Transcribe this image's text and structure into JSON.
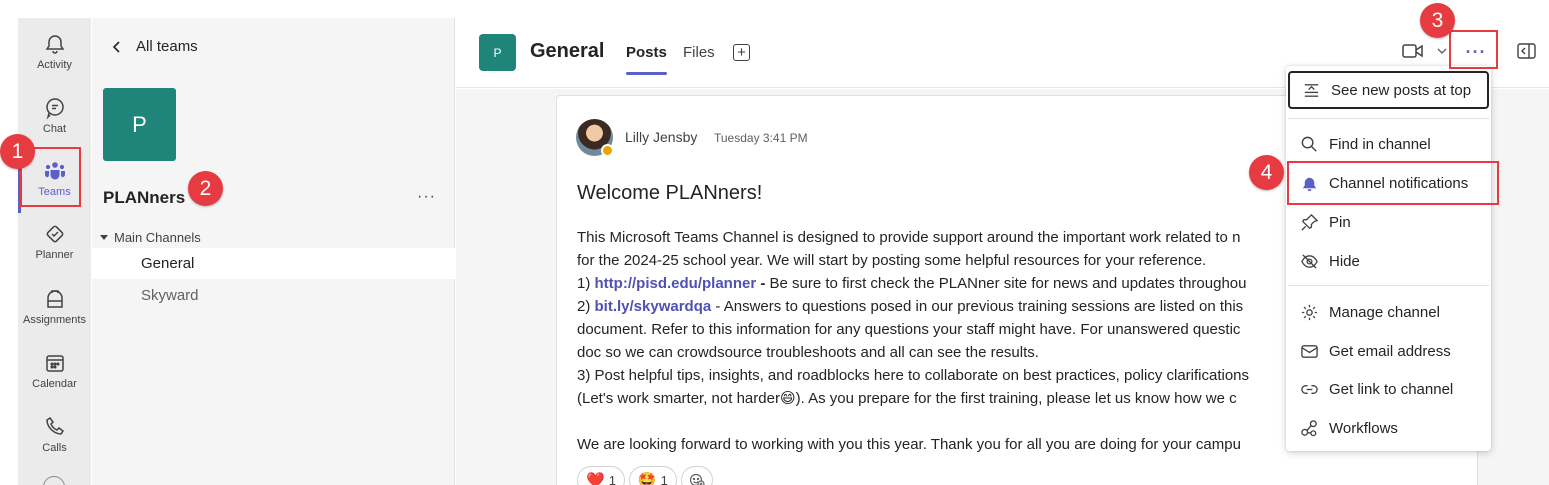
{
  "rail": {
    "items": [
      {
        "label": "Activity",
        "icon": "bell-icon"
      },
      {
        "label": "Chat",
        "icon": "chat-icon"
      },
      {
        "label": "Teams",
        "icon": "teams-icon"
      },
      {
        "label": "Planner",
        "icon": "planner-icon"
      },
      {
        "label": "Assignments",
        "icon": "assignments-icon"
      },
      {
        "label": "Calendar",
        "icon": "calendar-icon"
      },
      {
        "label": "Calls",
        "icon": "phone-icon"
      }
    ],
    "active_color": "#5b5fc7"
  },
  "teams_panel": {
    "back_label": "All teams",
    "team_initial": "P",
    "team_name": "PLANners",
    "more_label": "···",
    "section_label": "Main Channels",
    "channels": [
      "General",
      "Skyward"
    ]
  },
  "header": {
    "channel_initial": "P",
    "channel_name": "General",
    "tabs": [
      "Posts",
      "Files"
    ],
    "add_tab_label": "+",
    "more_label": "···"
  },
  "post": {
    "author": "Lilly Jensby",
    "time": "Tuesday 3:41 PM",
    "title": "Welcome PLANners!",
    "lines": {
      "l1": "This Microsoft Teams Channel is designed to provide support around the important work related to n",
      "l2": "for the 2024-25 school year.  We will start by posting some helpful resources for your reference.",
      "l3_prefix": "1) ",
      "l3_link": "http://pisd.edu/planner",
      "l3_dash": " - ",
      "l3_rest": "Be sure to first check the PLANner site for news and updates throughou",
      "l4_prefix": "2) ",
      "l4_link": "bit.ly/skywardqa",
      "l4_rest": "  - Answers to questions posed in our previous training sessions are listed on this",
      "l5": "document.  Refer to this information for any questions your staff might have.  For unanswered questic",
      "l6": "doc so we can crowdsource troubleshoots and all can see the results.",
      "l7": "3) Post helpful tips, insights, and roadblocks here to collaborate on best practices, policy clarifications",
      "l8": "(Let's work smarter, not harder😄).  As you prepare for the first training, please let us know how we c",
      "l9": "",
      "l10": "We are looking forward to working with you this year.  Thank you for all you are doing for your campu"
    },
    "reactions": [
      {
        "emoji": "❤️",
        "count": "1"
      },
      {
        "emoji": "🤩",
        "count": "1"
      }
    ]
  },
  "menu": {
    "items": [
      {
        "label": "See new posts at top",
        "icon": "sort-top-icon"
      },
      {
        "label": "Find in channel",
        "icon": "search-icon"
      },
      {
        "label": "Channel notifications",
        "icon": "bell-icon"
      },
      {
        "label": "Pin",
        "icon": "pin-icon"
      },
      {
        "label": "Hide",
        "icon": "eye-off-icon"
      },
      {
        "label": "Manage channel",
        "icon": "gear-icon"
      },
      {
        "label": "Get email address",
        "icon": "mail-icon"
      },
      {
        "label": "Get link to channel",
        "icon": "link-icon"
      },
      {
        "label": "Workflows",
        "icon": "workflows-icon"
      }
    ]
  },
  "callouts": [
    "1",
    "2",
    "3",
    "4"
  ],
  "colors": {
    "brand": "#5b5fc7",
    "team_avatar": "#1f847a",
    "callout": "#e63b40",
    "link": "#4f52b2"
  }
}
